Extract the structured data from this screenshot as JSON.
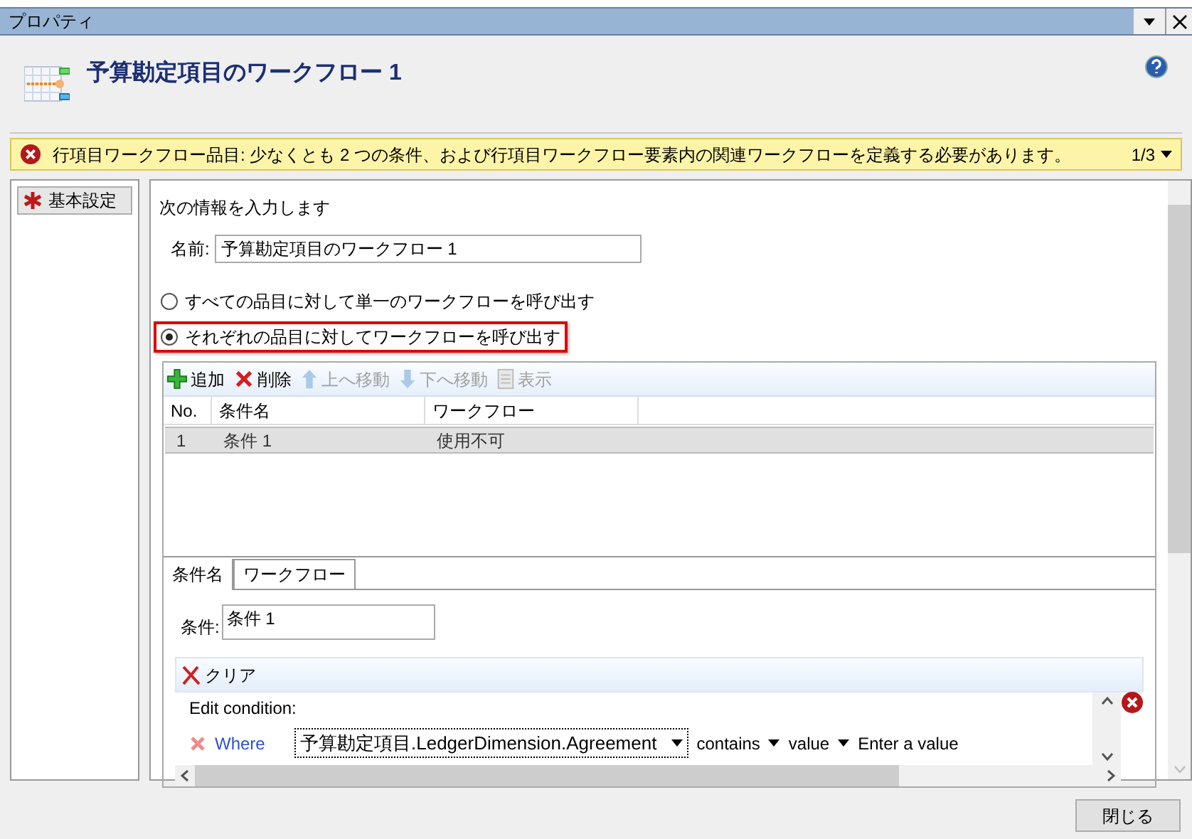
{
  "window": {
    "title": "プロパティ"
  },
  "header": {
    "title": "予算勘定項目のワークフロー 1"
  },
  "banner": {
    "message": "行項目ワークフロー品目: 少なくとも 2 つの条件、および行項目ワークフロー要素内の関連ワークフローを定義する必要があります。",
    "counter": "1/3"
  },
  "sidebar": {
    "items": [
      {
        "label": "基本設定"
      }
    ]
  },
  "form": {
    "instruction": "次の情報を入力します",
    "name_label": "名前:",
    "name_value": "予算勘定項目のワークフロー 1",
    "options": [
      {
        "label": "すべての品目に対して単一のワークフローを呼び出す",
        "selected": false
      },
      {
        "label": "それぞれの品目に対してワークフローを呼び出す",
        "selected": true
      }
    ]
  },
  "toolbar": [
    {
      "kind": "add",
      "label": "追加",
      "disabled": false
    },
    {
      "kind": "delete",
      "label": "削除",
      "disabled": false
    },
    {
      "kind": "up",
      "label": "上へ移動",
      "disabled": true
    },
    {
      "kind": "down",
      "label": "下へ移動",
      "disabled": true
    },
    {
      "kind": "view",
      "label": "表示",
      "disabled": true
    }
  ],
  "table": {
    "columns": [
      "No.",
      "条件名",
      "ワークフロー"
    ],
    "rows": [
      {
        "cells": [
          "1",
          "条件 1",
          "使用不可"
        ],
        "selected": true
      }
    ]
  },
  "tabs": [
    {
      "label": "条件名",
      "selected": true
    },
    {
      "label": "ワークフロー",
      "selected": false
    }
  ],
  "condition": {
    "label": "条件:",
    "value": "条件 1",
    "clear": "クリア",
    "edit_label": "Edit condition:",
    "where": "Where",
    "field": "予算勘定項目.LedgerDimension.Agreement",
    "operator": "contains",
    "operand_kind": "value",
    "operand": "Enter a value"
  },
  "buttons": [
    "閉じる"
  ]
}
